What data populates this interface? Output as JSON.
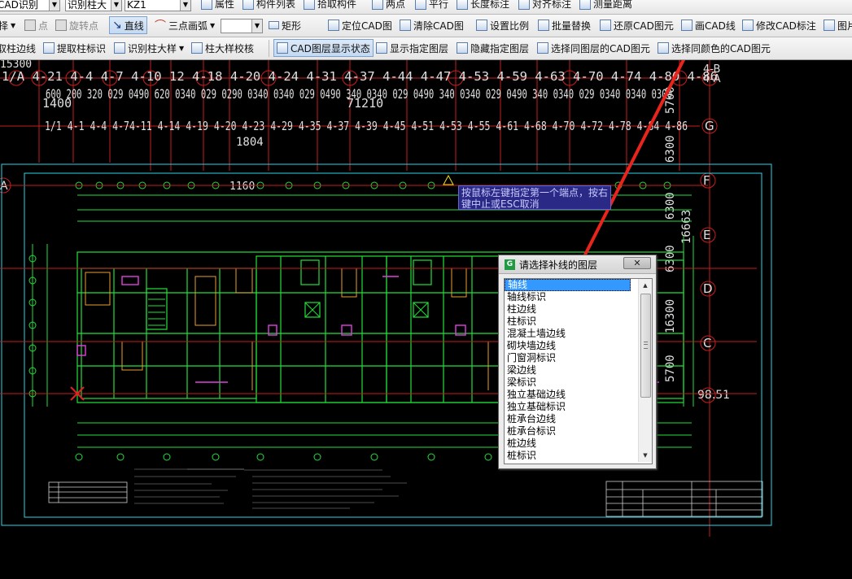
{
  "toolbar1": {
    "combo1": "CAD识别",
    "combo2": "识别柱大",
    "combo3": "KZ1",
    "props": "属性",
    "component_list": "构件列表",
    "pick_component": "拾取构件",
    "two_points": "两点",
    "parallel": "平行",
    "length_dim": "长度标注",
    "align_dim": "对齐标注",
    "measure": "测量距离"
  },
  "toolbar2": {
    "select": "择",
    "point": "点",
    "rotate_point": "旋转点",
    "line": "直线",
    "arc": "三点画弧",
    "rect": "矩形",
    "locate_cad": "定位CAD图",
    "clear_cad": "清除CAD图",
    "set_scale": "设置比例",
    "batch_replace": "批量替换",
    "restore_cad": "还原CAD图元",
    "draw_cad_line": "画CAD线",
    "edit_cad_dim": "修改CAD标注",
    "picture": "图片"
  },
  "toolbar3": {
    "extract_col_edge": "取柱边线",
    "extract_col_mark": "提取柱标识",
    "recognize_col_detail": "识别柱大样",
    "col_detail_check": "柱大样校核",
    "layer_display": "CAD图层显示状态",
    "show_layer": "显示指定图层",
    "hide_layer": "隐藏指定图层",
    "select_same_layer": "选择同图层的CAD图元",
    "select_same_color": "选择同颜色的CAD图元"
  },
  "cad": {
    "axis_row_top": "1/A 4-21 4-4 4-7 4-10 12 4-18 4-20 4-24 4-31 4-37 4-44 4-47 4-53 4-59 4-63 4-70 4-74 4-80 4-86",
    "axis_row_mid": "1/1 4-1 4-4 4-74-11 4-14 4-19 4-20 4-23 4-29 4-35 4-37 4-39 4-45 4-51 4-53 4-55 4-61 4-68 4-70 4-72 4-78 4-84 4-86",
    "dims_row": "600 200 320 029 0490 620 0340 029 0290 0340 0340 029 0490 340 0340 029 0490 340 0340 029 0490 340 0340 029 0340 0340 0300",
    "dim_1400": "1400",
    "dim_71210": "71210",
    "dim_1804": "1804",
    "dim_1160": "1160",
    "dim_15300": "15300",
    "label_A_left": "A",
    "label_G": "G",
    "label_F": "F",
    "label_E": "E",
    "label_D": "D",
    "label_C": "C",
    "label_4B": "4-B",
    "label_4A": "4-A",
    "label_9851": "98.51",
    "vertical_dims": [
      "5700",
      "6300",
      "16663",
      "6300",
      "16300",
      "6300",
      "5700"
    ]
  },
  "tooltip": {
    "line1": "按鼠标左键指定第一个端点，按右",
    "line2": "键中止或ESC取消"
  },
  "dialog": {
    "title": "请选择补线的图层",
    "close": "✕",
    "items": [
      "轴线",
      "轴线标识",
      "柱边线",
      "柱标识",
      "混凝土墙边线",
      "砌块墙边线",
      "门窗洞标识",
      "梁边线",
      "梁标识",
      "独立基础边线",
      "独立基础标识",
      "桩承台边线",
      "桩承台标识",
      "桩边线",
      "桩标识"
    ],
    "selected_index": 0
  },
  "colors": {
    "arrow": "#e8241c",
    "canvas_bg": "#000000",
    "wall_green": "#22e03a",
    "axis_red": "#d22020",
    "cyan": "#22d8e8"
  }
}
